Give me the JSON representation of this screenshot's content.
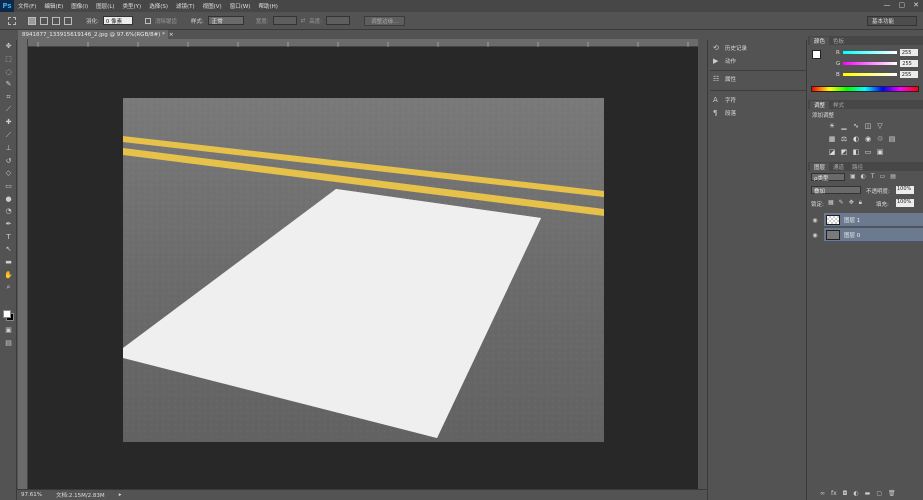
{
  "app": {
    "logo": "Ps",
    "menu": [
      "文件(F)",
      "编辑(E)",
      "图像(I)",
      "图层(L)",
      "类型(Y)",
      "选择(S)",
      "滤镜(T)",
      "视图(V)",
      "窗口(W)",
      "帮助(H)"
    ],
    "window_controls": [
      "—",
      "▢",
      "✕"
    ]
  },
  "options": {
    "feather_label": "羽化:",
    "feather_value": "0 像素",
    "antialias_label": "消除锯齿",
    "style_label": "样式:",
    "style_value": "正常",
    "width_label": "宽度:",
    "height_label": "高度:",
    "refine_edge_label": "调整边缘...",
    "workspace": "基本功能"
  },
  "document": {
    "tab_title": "8941877_133915619146_2.jpg @ 97.6%(RGB/8#) *",
    "tab_close": "×"
  },
  "status": {
    "zoom": "97.61%",
    "doc_size": "文档:2.15M/2.83M"
  },
  "mid_panel": {
    "history": "历史记录",
    "actions": "动作",
    "properties": "属性",
    "character": "字符",
    "paragraph": "段落"
  },
  "color_panel": {
    "tabs": [
      "颜色",
      "色板"
    ],
    "r_label": "R",
    "r_value": "255",
    "g_label": "G",
    "g_value": "255",
    "b_label": "B",
    "b_value": "255"
  },
  "adjustments_panel": {
    "tabs": [
      "调整",
      "样式"
    ],
    "title": "添加调整"
  },
  "layers_panel": {
    "tabs": [
      "图层",
      "通道",
      "路径"
    ],
    "kind_filter": "ρ类型",
    "blend_mode": "叠加",
    "opacity_label": "不透明度:",
    "opacity_value": "100%",
    "lock_label": "锁定:",
    "fill_label": "填充:",
    "fill_value": "100%",
    "layers": [
      {
        "name": "图层 1"
      },
      {
        "name": "图层 0"
      }
    ]
  },
  "colors": {
    "ps_blue": "#37a9f2",
    "road_yellow": "#e6c24a",
    "road_white": "#f2f2f2",
    "asphalt": "#6f6f6f",
    "layer_selected": "#6b7a8f"
  }
}
